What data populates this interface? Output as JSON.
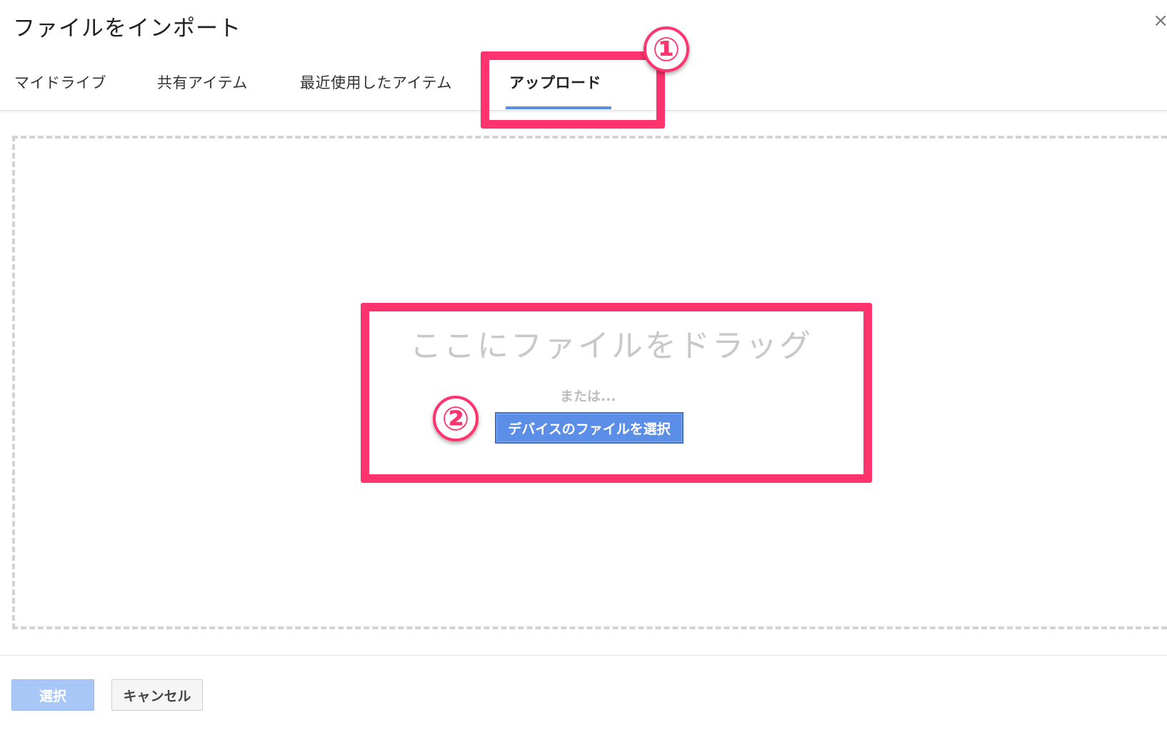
{
  "dialog": {
    "title": "ファイルをインポート",
    "close_glyph": "×"
  },
  "tabs": [
    {
      "label": "マイドライブ",
      "active": false
    },
    {
      "label": "共有アイテム",
      "active": false
    },
    {
      "label": "最近使用したアイテム",
      "active": false
    },
    {
      "label": "アップロード",
      "active": true
    }
  ],
  "dropzone": {
    "drag_text": "ここにファイルをドラッグ",
    "or_text": "または...",
    "device_button_label": "デバイスのファイルを選択"
  },
  "annotations": {
    "badge_1": "①",
    "badge_2": "②",
    "highlight_color": "#ff336e"
  },
  "footer": {
    "select_label": "選択",
    "cancel_label": "キャンセル"
  },
  "colors": {
    "accent": "#5b8ee6",
    "select_disabled": "#a8c7f7"
  }
}
